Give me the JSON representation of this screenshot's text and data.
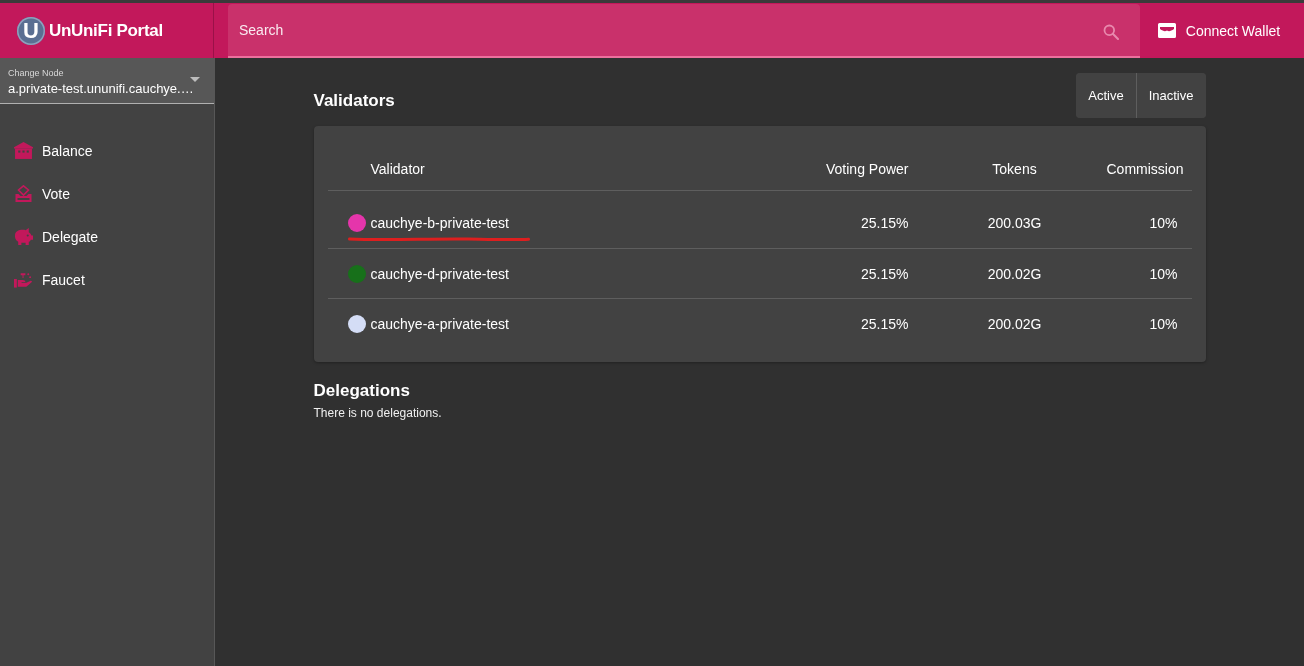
{
  "header": {
    "logo_letter": "U",
    "title": "UnUniFi Portal",
    "search": {
      "placeholder": "Search"
    },
    "connect_button": "Connect Wallet"
  },
  "sidebar": {
    "node_select": {
      "label": "Change Node",
      "value": "a.private-test.ununifi.cauchye.…"
    },
    "items": [
      {
        "label": "Balance"
      },
      {
        "label": "Vote"
      },
      {
        "label": "Delegate"
      },
      {
        "label": "Faucet"
      }
    ]
  },
  "validators": {
    "title": "Validators",
    "filters": [
      {
        "label": "Active",
        "selected": false
      },
      {
        "label": "Inactive",
        "selected": false
      }
    ],
    "table": {
      "columns": [
        "Validator",
        "Voting Power",
        "Tokens",
        "Commission"
      ],
      "rows": [
        {
          "color": "#e535ab",
          "name": "cauchye-b-private-test",
          "voting_power": "25.15%",
          "tokens": "200.03G",
          "commission": "10%",
          "underlined": true
        },
        {
          "color": "#17701a",
          "name": "cauchye-d-private-test",
          "voting_power": "25.15%",
          "tokens": "200.02G",
          "commission": "10%",
          "underlined": false
        },
        {
          "color": "#d4ddf6",
          "name": "cauchye-a-private-test",
          "voting_power": "25.15%",
          "tokens": "200.02G",
          "commission": "10%",
          "underlined": false
        }
      ]
    }
  },
  "delegations": {
    "title": "Delegations",
    "message": "There is no delegations."
  }
}
